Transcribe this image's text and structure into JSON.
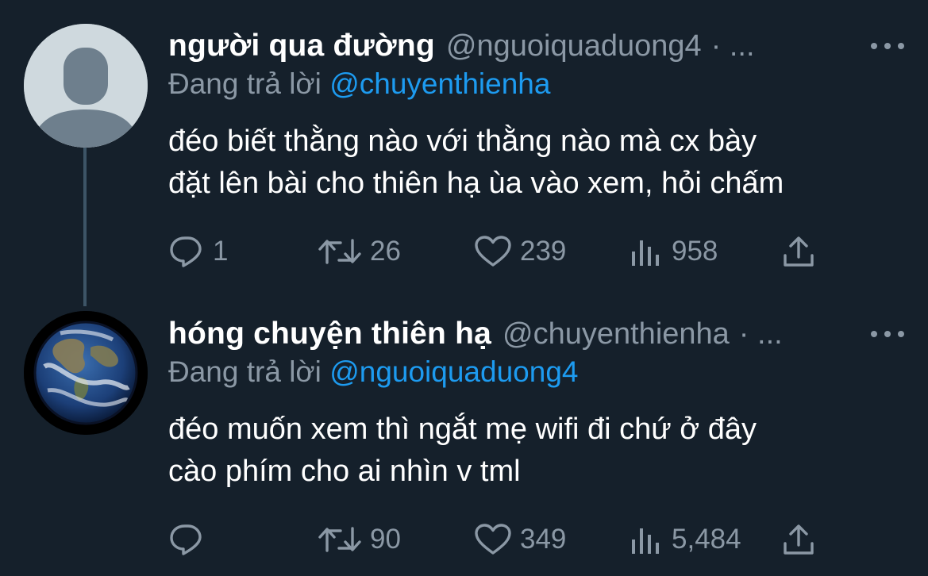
{
  "tweets": [
    {
      "display_name": "người qua đường",
      "handle": "@nguoiquaduong4",
      "separator": "· ...",
      "reply_prefix": "Đang trả lời",
      "reply_to": "@chuyenthienha",
      "text_line1": "đéo biết thằng nào với thằng nào mà cx bày",
      "text_line2": "đặt lên bài cho thiên hạ ùa vào xem, hỏi chấm",
      "replies": "1",
      "retweets": "26",
      "likes": "239",
      "views": "958",
      "avatar": "default-profile-avatar"
    },
    {
      "display_name": "hóng chuyện thiên hạ",
      "handle": "@chuyenthienha",
      "separator": "· ...",
      "reply_prefix": "Đang trả lời",
      "reply_to": "@nguoiquaduong4",
      "text_line1": "đéo muốn xem thì ngắt mẹ wifi đi chứ ở đây",
      "text_line2": "cào phím cho ai nhìn v tml",
      "replies": "",
      "retweets": "90",
      "likes": "349",
      "views": "5,484",
      "avatar": "earth-globe-avatar"
    }
  ],
  "colors": {
    "background": "#15202b",
    "text_primary": "#ffffff",
    "text_secondary": "#8b98a5",
    "link": "#1d9bf0",
    "thread_line": "#3d5466"
  },
  "icons": [
    "reply-icon",
    "retweet-icon",
    "like-icon",
    "views-icon",
    "share-icon",
    "more-icon"
  ]
}
